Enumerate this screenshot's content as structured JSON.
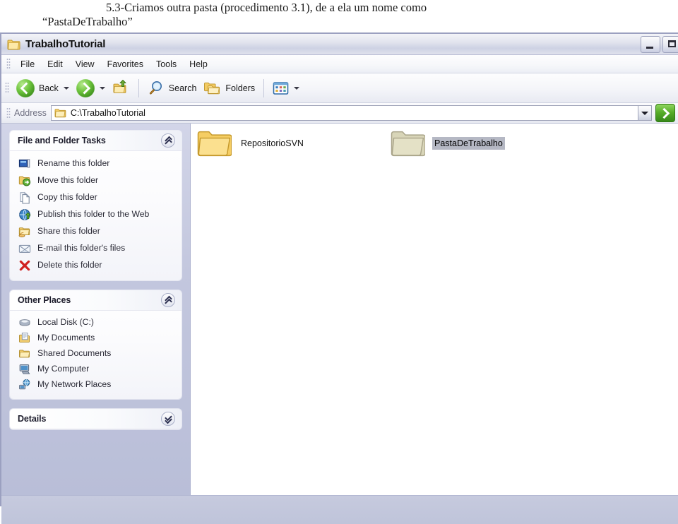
{
  "caption": {
    "line1": "5.3-Criamos outra pasta (procedimento 3.1), de a ela um nome como",
    "line2": "“PastaDeTrabalho”"
  },
  "window": {
    "title": "TrabalhoTutorial",
    "title_icon": "folder-icon",
    "buttons": {
      "minimize": "minimize-icon",
      "maximize": "maximize-icon"
    }
  },
  "menubar": {
    "items": [
      {
        "label": "File"
      },
      {
        "label": "Edit"
      },
      {
        "label": "View"
      },
      {
        "label": "Favorites"
      },
      {
        "label": "Tools"
      },
      {
        "label": "Help"
      }
    ]
  },
  "toolbar": {
    "back_label": "Back",
    "search_label": "Search",
    "folders_label": "Folders",
    "icons": {
      "back": "back-arrow-icon",
      "forward": "forward-arrow-icon",
      "up": "up-folder-icon",
      "search": "magnifier-icon",
      "folders": "folders-icon",
      "views": "views-icon"
    }
  },
  "address": {
    "label": "Address",
    "value": "C:\\TrabalhoTutorial",
    "placeholder": "C:\\TrabalhoTutorial",
    "icon": "folder-icon",
    "go_label": "Go"
  },
  "taskpane": {
    "file_folder_tasks": {
      "title": "File and Folder Tasks",
      "collapse_state": "expanded",
      "items": [
        {
          "label": "Rename this folder",
          "icon": "rename-icon"
        },
        {
          "label": "Move this folder",
          "icon": "move-folder-icon"
        },
        {
          "label": "Copy this folder",
          "icon": "copy-icon"
        },
        {
          "label": "Publish this folder to the Web",
          "icon": "publish-web-icon"
        },
        {
          "label": "Share this folder",
          "icon": "share-folder-icon"
        },
        {
          "label": "E-mail this folder's files",
          "icon": "email-icon"
        },
        {
          "label": "Delete this folder",
          "icon": "delete-x-icon"
        }
      ]
    },
    "other_places": {
      "title": "Other Places",
      "collapse_state": "expanded",
      "items": [
        {
          "label": "Local Disk (C:)",
          "icon": "hard-disk-icon"
        },
        {
          "label": "My Documents",
          "icon": "my-documents-icon"
        },
        {
          "label": "Shared Documents",
          "icon": "shared-documents-icon"
        },
        {
          "label": "My Computer",
          "icon": "my-computer-icon"
        },
        {
          "label": "My Network Places",
          "icon": "network-places-icon"
        }
      ]
    },
    "details": {
      "title": "Details",
      "collapse_state": "collapsed"
    }
  },
  "content": {
    "items": [
      {
        "label": "RepositorioSVN",
        "icon": "folder-icon",
        "selected": false
      },
      {
        "label": "PastaDeTrabalho",
        "icon": "folder-icon",
        "selected": true
      }
    ]
  },
  "colors": {
    "selection": "#b5b8c4",
    "folder_yellow": "#f3cc62",
    "accent_green": "#4fa11f",
    "pane_background": "#c1c5dc"
  }
}
